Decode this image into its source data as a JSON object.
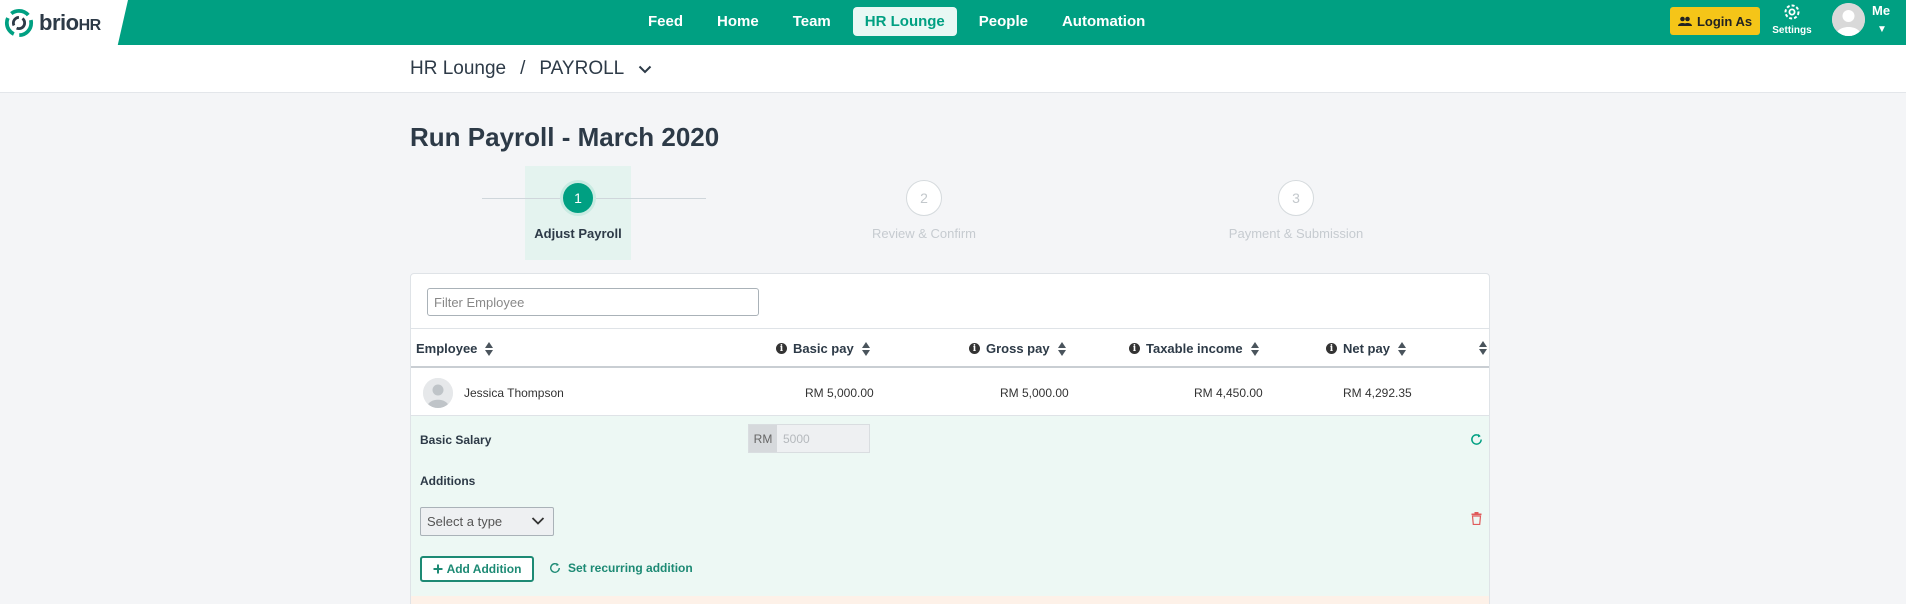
{
  "brand": {
    "name": "brio",
    "suffix": "HR"
  },
  "nav": {
    "items": [
      {
        "label": "Feed"
      },
      {
        "label": "Home"
      },
      {
        "label": "Team"
      },
      {
        "label": "HR Lounge",
        "active": true
      },
      {
        "label": "People"
      },
      {
        "label": "Automation"
      }
    ]
  },
  "topright": {
    "login_as": "Login As",
    "settings": "Settings",
    "me": "Me"
  },
  "breadcrumb": {
    "parent": "HR Lounge",
    "separator": "/",
    "current": "PAYROLL"
  },
  "page": {
    "title": "Run Payroll - March 2020"
  },
  "steps": [
    {
      "number": "1",
      "label": "Adjust Payroll",
      "active": true
    },
    {
      "number": "2",
      "label": "Review & Confirm",
      "active": false
    },
    {
      "number": "3",
      "label": "Payment & Submission",
      "active": false
    }
  ],
  "filter": {
    "placeholder": "Filter Employee"
  },
  "table": {
    "headers": {
      "employee": "Employee",
      "basic": "Basic pay",
      "gross": "Gross pay",
      "taxable": "Taxable income",
      "net": "Net pay"
    },
    "rows": [
      {
        "employee": "Jessica Thompson",
        "basic": "RM 5,000.00",
        "gross": "RM 5,000.00",
        "taxable": "RM 4,450.00",
        "net": "RM 4,292.35"
      }
    ]
  },
  "detail": {
    "basic_salary_label": "Basic Salary",
    "currency": "RM",
    "basic_salary_value": "5000",
    "additions_label": "Additions",
    "select_type_placeholder": "Select a type",
    "add_addition": "Add Addition",
    "set_recurring": "Set recurring addition"
  },
  "colors": {
    "brand": "#00a082",
    "login_as": "#f5c518",
    "accent_text": "#1d8a74",
    "delete": "#e05a5a"
  },
  "icons": [
    "logo-icon",
    "users-icon",
    "gear-icon",
    "user-avatar-icon",
    "chevron-down-icon",
    "sort-icon",
    "info-icon",
    "refresh-icon",
    "trash-icon",
    "plus-icon"
  ]
}
